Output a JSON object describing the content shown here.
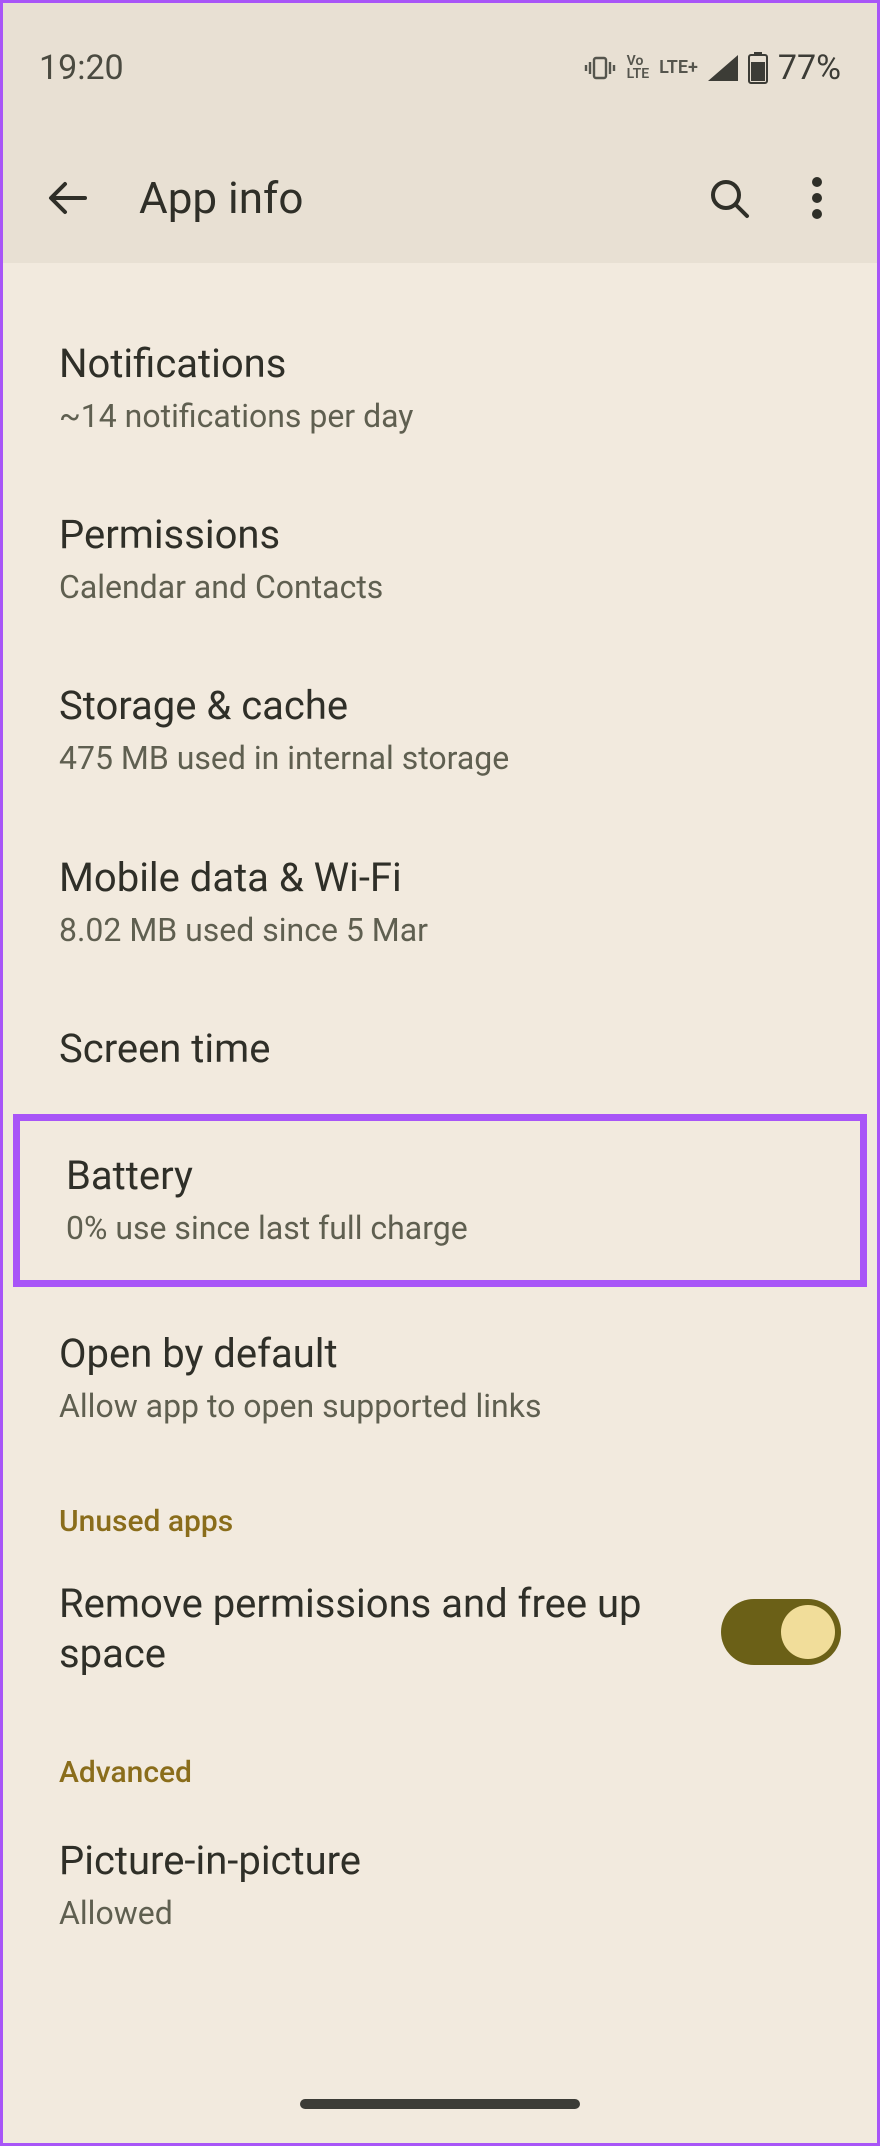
{
  "status": {
    "time": "19:20",
    "volte": "Vo\nLTE",
    "lte": "LTE+",
    "battery_pct": "77%"
  },
  "appbar": {
    "title": "App info"
  },
  "items": {
    "notifications": {
      "title": "Notifications",
      "sub": "~14 notifications per day"
    },
    "permissions": {
      "title": "Permissions",
      "sub": "Calendar and Contacts"
    },
    "storage": {
      "title": "Storage & cache",
      "sub": "475 MB used in internal storage"
    },
    "mobiledata": {
      "title": "Mobile data & Wi‑Fi",
      "sub": "8.02 MB used since 5 Mar"
    },
    "screentime": {
      "title": "Screen time"
    },
    "battery": {
      "title": "Battery",
      "sub": "0% use since last full charge"
    },
    "openbydefault": {
      "title": "Open by default",
      "sub": "Allow app to open supported links"
    },
    "pip": {
      "title": "Picture-in-picture",
      "sub": "Allowed"
    }
  },
  "sections": {
    "unused": "Unused apps",
    "advanced": "Advanced"
  },
  "toggle": {
    "remove_perms": "Remove permissions and free up space",
    "state": true
  }
}
